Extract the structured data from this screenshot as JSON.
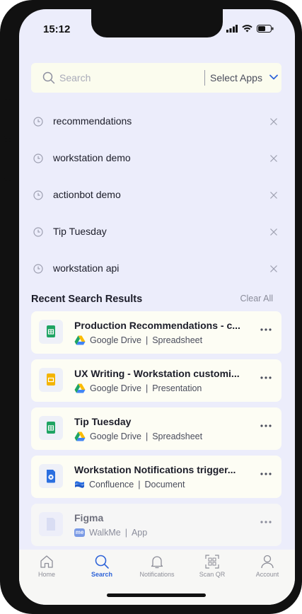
{
  "status_bar": {
    "time": "15:12"
  },
  "search": {
    "placeholder": "Search",
    "select_apps": "Select Apps"
  },
  "recent_searches": [
    {
      "label": "recommendations"
    },
    {
      "label": "workstation demo"
    },
    {
      "label": "actionbot demo"
    },
    {
      "label": "Tip Tuesday"
    },
    {
      "label": "workstation api"
    }
  ],
  "results_section": {
    "title": "Recent Search Results",
    "clear_all": "Clear All"
  },
  "results": [
    {
      "title": "Production Recommendations - c...",
      "source": "Google Drive",
      "type": "Spreadsheet",
      "file_icon": "sheets-icon",
      "app_icon": "google-drive-icon"
    },
    {
      "title": "UX Writing - Workstation customi...",
      "source": "Google Drive",
      "type": "Presentation",
      "file_icon": "slides-icon",
      "app_icon": "google-drive-icon"
    },
    {
      "title": "Tip Tuesday",
      "source": "Google Drive",
      "type": "Spreadsheet",
      "file_icon": "sheets-icon",
      "app_icon": "google-drive-icon"
    },
    {
      "title": "Workstation Notifications trigger...",
      "source": "Confluence",
      "type": "Document",
      "file_icon": "confluence-doc-icon",
      "app_icon": "confluence-icon"
    },
    {
      "title": "Figma",
      "source": "WalkMe",
      "type": "App",
      "file_icon": "generic-file-icon",
      "app_icon": "walkme-icon",
      "app_icon_text": "me"
    }
  ],
  "tabs": [
    {
      "label": "Home",
      "icon": "home-icon"
    },
    {
      "label": "Search",
      "icon": "search-icon",
      "active": true
    },
    {
      "label": "Notifications",
      "icon": "bell-icon"
    },
    {
      "label": "Scan QR",
      "icon": "qr-scan-icon"
    },
    {
      "label": "Account",
      "icon": "person-icon"
    }
  ],
  "colors": {
    "background": "#ecedfb",
    "accent": "#2f64d8",
    "sheets_green": "#1fa463",
    "slides_yellow": "#f4b400",
    "confluence_blue": "#2b6fe0"
  }
}
